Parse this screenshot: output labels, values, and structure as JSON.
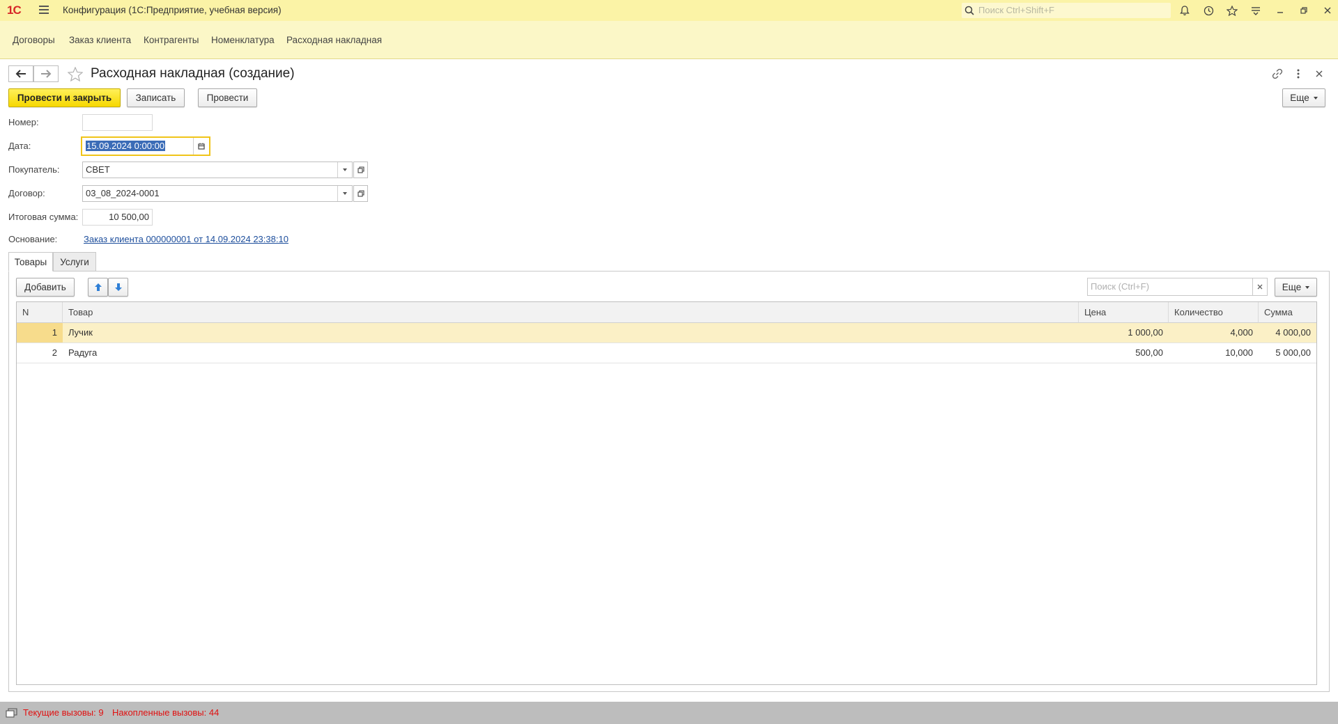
{
  "titlebar": {
    "logo": "1С",
    "title": "Конфигурация  (1С:Предприятие, учебная версия)",
    "search_placeholder": "Поиск Ctrl+Shift+F"
  },
  "sections": [
    "Договоры",
    "Заказ клиента",
    "Контрагенты",
    "Номенклатура",
    "Расходная накладная"
  ],
  "form": {
    "title": "Расходная накладная (создание)",
    "buttons": {
      "post_close": "Провести и закрыть",
      "save": "Записать",
      "post": "Провести",
      "more": "Еще"
    },
    "fields": {
      "number_label": "Номер:",
      "number_value": "",
      "date_label": "Дата:",
      "date_value": "15.09.2024  0:00:00",
      "buyer_label": "Покупатель:",
      "buyer_value": "СВЕТ",
      "contract_label": "Договор:",
      "contract_value": "03_08_2024-0001",
      "total_label": "Итоговая сумма:",
      "total_value": "10 500,00",
      "basis_label": "Основание:",
      "basis_link": "Заказ клиента 000000001 от 14.09.2024 23:38:10"
    },
    "tabs": [
      "Товары",
      "Услуги"
    ],
    "table_toolbar": {
      "add": "Добавить",
      "search_placeholder": "Поиск (Ctrl+F)",
      "more": "Еще"
    },
    "table": {
      "columns": [
        "N",
        "Товар",
        "Цена",
        "Количество",
        "Сумма"
      ],
      "rows": [
        {
          "n": "1",
          "item": "Лучик",
          "price": "1 000,00",
          "qty": "4,000",
          "sum": "4 000,00"
        },
        {
          "n": "2",
          "item": "Радуга",
          "price": "500,00",
          "qty": "10,000",
          "sum": "5 000,00"
        }
      ]
    }
  },
  "status": {
    "current_calls": "Текущие вызовы: 9",
    "accumulated_calls": "Накопленные вызовы: 44"
  },
  "colors": {
    "titlebar_bg": "#fbf3a6",
    "primary_button": "#f6d800",
    "active_row": "#fbf0c6",
    "status_text": "#e01010",
    "link": "#1d4e9c"
  }
}
